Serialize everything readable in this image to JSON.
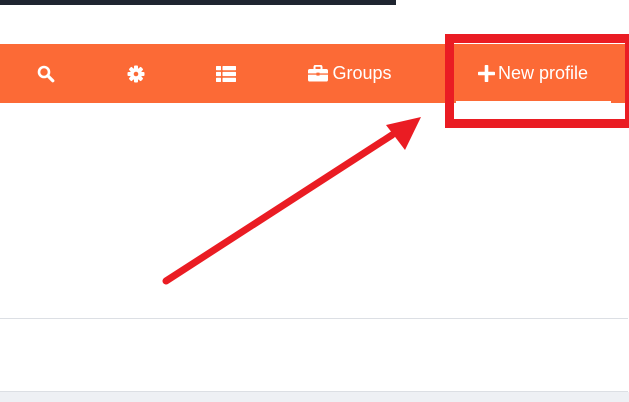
{
  "toolbar": {
    "background_color": "#fc6a36",
    "text_color": "#ffffff",
    "items": [
      {
        "icon": "search-icon"
      },
      {
        "icon": "gear-icon"
      },
      {
        "icon": "list-icon"
      },
      {
        "icon": "briefcase-icon",
        "label": "Groups"
      },
      {
        "icon": "plus-icon",
        "label": "New profile"
      }
    ]
  },
  "annotation": {
    "highlight_color": "#ea1c23",
    "arrow_color": "#ea1c23"
  }
}
